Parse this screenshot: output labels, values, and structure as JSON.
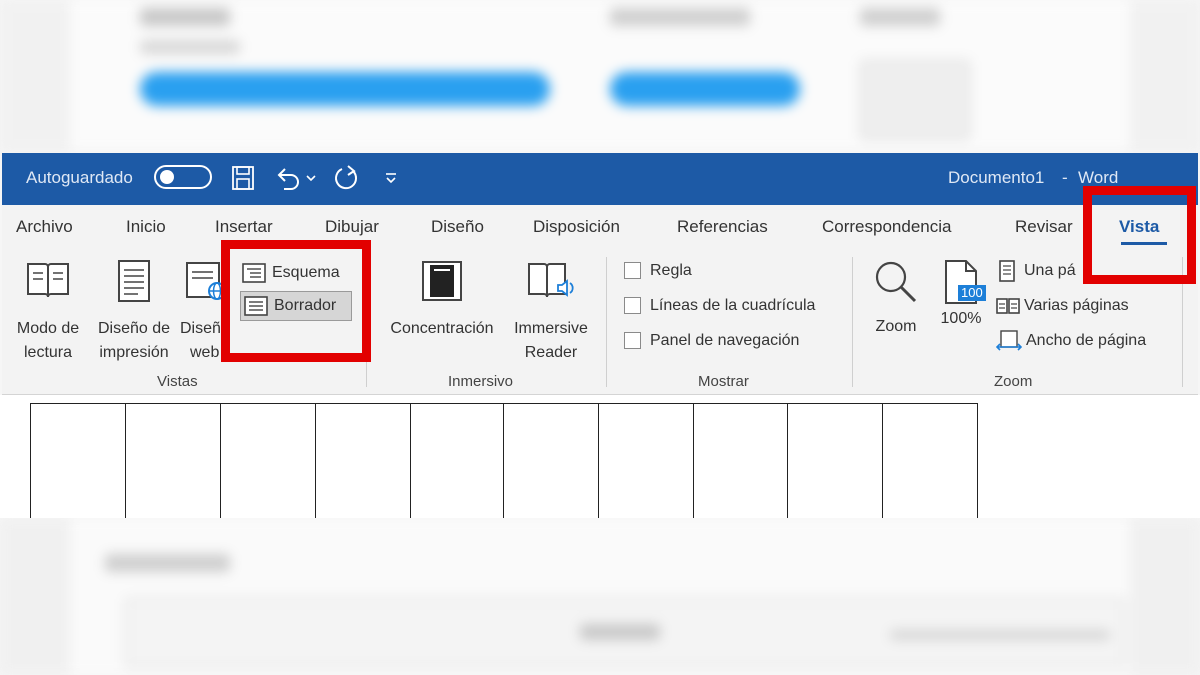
{
  "titlebar": {
    "autosave_label": "Autoguardado",
    "doc_title": "Documento1",
    "separator": "-",
    "app_name": "Word"
  },
  "tabs": [
    "Archivo",
    "Inicio",
    "Insertar",
    "Dibujar",
    "Diseño",
    "Disposición",
    "Referencias",
    "Correspondencia",
    "Revisar",
    "Vista"
  ],
  "active_tab": "Vista",
  "ribbon": {
    "vistas": {
      "group_label": "Vistas",
      "read_mode": [
        "Modo de",
        "lectura"
      ],
      "print_layout": [
        "Diseño de",
        "impresión"
      ],
      "web_layout": [
        "Diseñ",
        "web"
      ],
      "outline": "Esquema",
      "draft": "Borrador"
    },
    "inmersivo": {
      "group_label": "Inmersivo",
      "focus": "Concentración",
      "immersive_reader": [
        "Immersive",
        "Reader"
      ]
    },
    "mostrar": {
      "group_label": "Mostrar",
      "ruler": "Regla",
      "gridlines": "Líneas de la cuadrícula",
      "nav_pane": "Panel de navegación"
    },
    "zoom": {
      "group_label": "Zoom",
      "zoom": "Zoom",
      "hundred": "100%",
      "hundred_icon": "100",
      "one_page": "Una pá",
      "multi_pages": "Varias páginas",
      "page_width": "Ancho de página"
    }
  },
  "colors": {
    "titlebar": "#1d5aa6",
    "highlight": "#e20000",
    "accent": "#1d5aa6"
  }
}
